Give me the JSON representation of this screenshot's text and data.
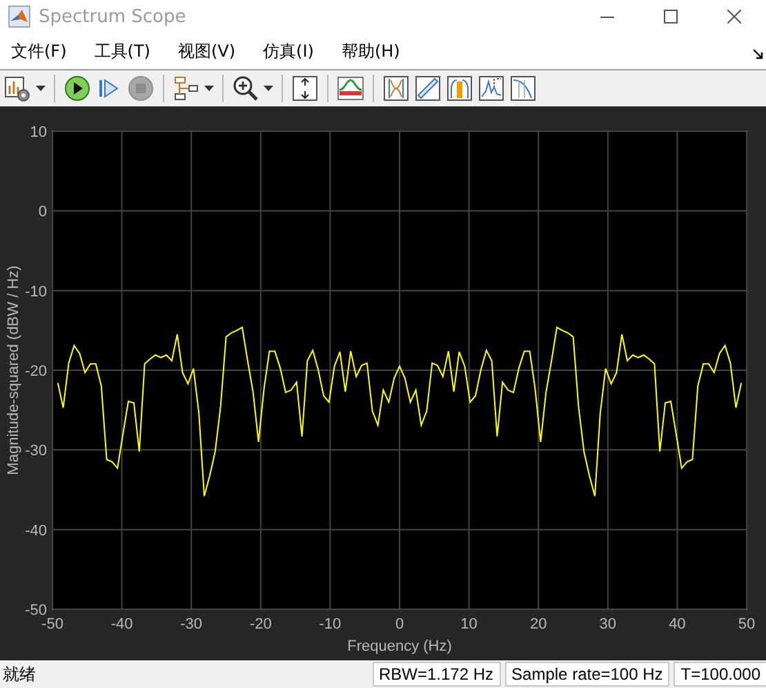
{
  "window": {
    "title": "Spectrum Scope"
  },
  "menu": [
    {
      "label": "文件(F)"
    },
    {
      "label": "工具(T)"
    },
    {
      "label": "视图(V)"
    },
    {
      "label": "仿真(I)"
    },
    {
      "label": "帮助(H)"
    }
  ],
  "toolbar": {
    "stop_enabled": false
  },
  "plot": {
    "chart_data": {
      "type": "line",
      "grid": true,
      "xlabel": "Frequency (Hz)",
      "ylabel": "Magnitude-squared (dBW / Hz)",
      "xlim": [
        -50,
        50
      ],
      "ylim": [
        -50,
        10
      ],
      "xticks": [
        -50,
        -40,
        -30,
        -20,
        -10,
        0,
        10,
        20,
        30,
        40,
        50
      ],
      "yticks": [
        -50,
        -40,
        -30,
        -20,
        -10,
        0,
        10
      ],
      "x": [
        -49.22,
        -48.44,
        -47.66,
        -46.88,
        -46.09,
        -45.31,
        -44.53,
        -43.75,
        -42.97,
        -42.19,
        -41.41,
        -40.63,
        -39.84,
        -39.06,
        -38.28,
        -37.5,
        -36.72,
        -35.94,
        -35.16,
        -34.38,
        -33.59,
        -32.81,
        -32.03,
        -31.25,
        -30.47,
        -29.69,
        -28.91,
        -28.13,
        -27.34,
        -26.56,
        -25.78,
        -25,
        -24.22,
        -23.44,
        -22.66,
        -21.88,
        -21.09,
        -20.31,
        -19.53,
        -18.75,
        -17.97,
        -17.19,
        -16.41,
        -15.63,
        -14.84,
        -14.06,
        -13.28,
        -12.5,
        -11.72,
        -10.94,
        -10.16,
        -9.38,
        -8.59,
        -7.81,
        -7.03,
        -6.25,
        -5.47,
        -4.69,
        -3.91,
        -3.13,
        -2.34,
        -1.56,
        -0.78,
        0,
        0.78,
        1.56,
        2.34,
        3.13,
        3.91,
        4.69,
        5.47,
        6.25,
        7.03,
        7.81,
        8.59,
        9.38,
        10.16,
        10.94,
        11.72,
        12.5,
        13.28,
        14.06,
        14.84,
        15.63,
        16.41,
        17.19,
        17.97,
        18.75,
        19.53,
        20.31,
        21.09,
        21.88,
        22.66,
        23.44,
        24.22,
        25,
        25.78,
        26.56,
        27.34,
        28.13,
        28.91,
        29.69,
        30.47,
        31.25,
        32.03,
        32.81,
        33.59,
        34.38,
        35.16,
        35.94,
        36.72,
        37.5,
        38.28,
        39.06,
        39.84,
        40.63,
        41.41,
        42.19,
        42.97,
        43.75,
        44.53,
        45.31,
        46.09,
        46.88,
        47.66,
        48.44,
        49.22
      ],
      "series": [
        {
          "color": "#ffff00",
          "values": [
            -21.6,
            -24.7,
            -19.1,
            -16.9,
            -17.9,
            -20.3,
            -19.2,
            -19.2,
            -22,
            -31.2,
            -31.5,
            -32.3,
            -28,
            -23.9,
            -24.1,
            -30.2,
            -19.2,
            -18.6,
            -18.1,
            -18.4,
            -18.1,
            -18.8,
            -15.5,
            -20.3,
            -21.7,
            -19.8,
            -25.4,
            -35.8,
            -33.2,
            -30.2,
            -24.6,
            -15.8,
            -15.3,
            -15,
            -14.6,
            -18.8,
            -22.8,
            -29,
            -22.3,
            -17.6,
            -17.6,
            -19.7,
            -22.8,
            -22.5,
            -21.5,
            -28.3,
            -18.8,
            -17.5,
            -19.9,
            -23.2,
            -24,
            -19.5,
            -17.7,
            -22.7,
            -17.6,
            -20.8,
            -19.4,
            -19.1,
            -25.1,
            -26.9,
            -22.5,
            -24,
            -21,
            -19.5,
            -21,
            -24,
            -22.5,
            -26.9,
            -25.1,
            -19.1,
            -19.4,
            -20.8,
            -17.6,
            -22.7,
            -17.7,
            -19.5,
            -24,
            -23.2,
            -19.9,
            -17.5,
            -18.8,
            -28.3,
            -21.5,
            -22.5,
            -22.8,
            -19.7,
            -17.6,
            -17.6,
            -22.3,
            -29,
            -22.8,
            -18.8,
            -14.6,
            -15,
            -15.3,
            -15.8,
            -24.6,
            -30.2,
            -33.2,
            -35.8,
            -25.4,
            -19.8,
            -21.7,
            -20.3,
            -15.5,
            -18.8,
            -18.1,
            -18.4,
            -18.1,
            -18.6,
            -19.2,
            -30.2,
            -24.1,
            -23.9,
            -28,
            -32.3,
            -31.5,
            -31.2,
            -22,
            -19.2,
            -19.2,
            -20.3,
            -17.9,
            -16.9,
            -19.1,
            -24.7,
            -21.6
          ]
        }
      ]
    }
  },
  "status_bar": {
    "message": "就绪",
    "fields": [
      "RBW=1.172 Hz",
      "Sample rate=100 Hz",
      "T=100.000"
    ]
  }
}
